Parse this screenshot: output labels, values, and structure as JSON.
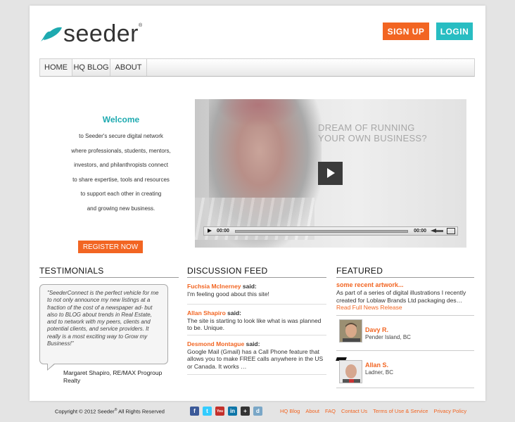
{
  "brand": {
    "name": "seeder",
    "reg": "®",
    "leaf_color": "#1eaab0"
  },
  "header": {
    "signup_label": "SIGN UP",
    "login_label": "LOGIN"
  },
  "nav": {
    "home": "HOME",
    "blog": "HQ BLOG",
    "about": "ABOUT"
  },
  "welcome": {
    "title": "Welcome",
    "lines": [
      "to Seeder's secure digital network",
      "where professionals, students, mentors,",
      "investors, and philanthropists connect",
      "to share expertise, tools and resources",
      "to support each other in creating",
      "and growing new business."
    ],
    "register_label": "REGISTER NOW"
  },
  "video": {
    "caption_line1": "DREAM OF RUNNING",
    "caption_line2": "YOUR OWN BUSINESS?",
    "time_current": "00:00",
    "time_total": "00:00"
  },
  "testimonials": {
    "title": "TESTIMONIALS",
    "quote": "\"SeederConnect is the perfect vehicle for me to not only announce my new listings at a fraction of the cost of a newspaper ad- but also to BLOG about trends in Real Estate, and to network with my peers, clients and potential clients, and service providers. It really is a most exciting way to Grow my Business!\"",
    "author": "Margaret Shapiro, RE/MAX Progroup Realty"
  },
  "discussion": {
    "title": "DISCUSSION FEED",
    "said": "said:",
    "items": [
      {
        "name": "Fuchsia McInerney",
        "text": "I'm feeling good about this site!"
      },
      {
        "name": "Allan Shapiro",
        "text": "The site is starting to look like what is was planned to be. Unique."
      },
      {
        "name": "Desmond Montague",
        "text": "Google Mail (Gmail) has a Call Phone feature that allows you to make FREE calls anywhere in the US or Canada. It works …"
      }
    ]
  },
  "featured": {
    "title": "FEATURED",
    "news_title": "some recent artwork...",
    "news_text": "As part of a series of digital illustrations I recently created for Loblaw Brands Ltd packaging des…",
    "news_link": "Read Full News Release",
    "people": [
      {
        "name": "Davy R.",
        "location": "Pender Island, BC"
      },
      {
        "name": "Allan S.",
        "location": "Ladner, BC"
      }
    ]
  },
  "footer": {
    "copyright_prefix": "Copyright © 2012 Seeder",
    "copyright_reg": "®",
    "copyright_suffix": " All Rights Reserved",
    "social": [
      {
        "icon": "facebook-icon",
        "glyph": "f",
        "color": "#3b5998"
      },
      {
        "icon": "twitter-icon",
        "glyph": "t",
        "color": "#33ccff"
      },
      {
        "icon": "youtube-icon",
        "glyph": "You",
        "color": "#c4302b"
      },
      {
        "icon": "linkedin-icon",
        "glyph": "in",
        "color": "#0e76a8"
      },
      {
        "icon": "plus-icon",
        "glyph": "+",
        "color": "#333333"
      },
      {
        "icon": "delicious-icon",
        "glyph": "d",
        "color": "#7aa7c7"
      }
    ],
    "links": [
      "HQ Blog",
      "About",
      "FAQ",
      "Contact Us",
      "Terms of Use & Service",
      "Privacy Policy"
    ]
  },
  "colors": {
    "orange": "#f26522",
    "teal": "#28bdc2"
  }
}
